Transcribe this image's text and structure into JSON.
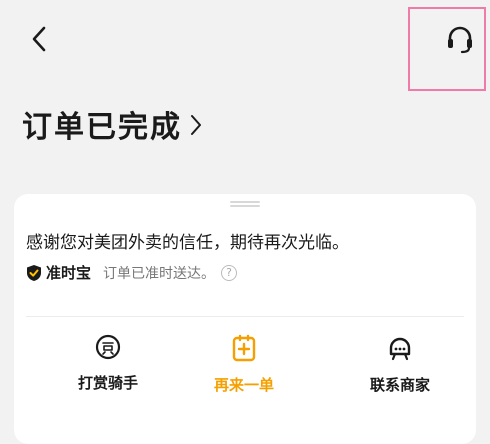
{
  "header": {
    "back_icon": "chevron-left-icon",
    "support_icon": "headset-icon"
  },
  "status": {
    "title": "订单已完成",
    "chevron_icon": "chevron-right-icon"
  },
  "card": {
    "thanks_text": "感谢您对美团外卖的信任，期待再次光临。",
    "badge_label": "准时宝",
    "ontime_text": "订单已准时送达。",
    "help_glyph": "?"
  },
  "actions": [
    {
      "label": "打赏骑手",
      "icon": "reward-icon"
    },
    {
      "label": "再来一单",
      "icon": "reorder-icon"
    },
    {
      "label": "联系商家",
      "icon": "merchant-icon"
    }
  ],
  "colors": {
    "accent": "#f5a000",
    "highlight_border": "#f07aa8",
    "background": "#f2f2f2"
  }
}
